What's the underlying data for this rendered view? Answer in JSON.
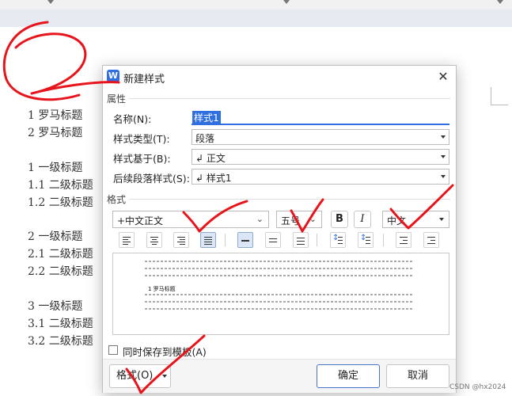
{
  "document": {
    "lines": [
      "1 罗马标题",
      "2 罗马标题",
      "1 一级标题",
      "1.1  二级标题",
      "1.2 二级标题",
      "2 一级标题",
      "2.1  二级标题",
      "2.2 二级标题",
      "3 一级标题",
      "3.1  二级标题",
      "3.2 二级标题"
    ]
  },
  "dialog": {
    "app_icon": "W",
    "title": "新建样式",
    "close_icon": "close-icon",
    "properties_section": "属性",
    "properties": {
      "name_label": "名称(N):",
      "name_value": "样式1",
      "type_label": "样式类型(T):",
      "type_value": "段落",
      "based_on_label": "样式基于(B):",
      "based_on_value": "↲ 正文",
      "next_label": "后续段落样式(S):",
      "next_value": "↲ 样式1"
    },
    "format_section": "格式",
    "format": {
      "font": "+中文正文",
      "size": "五号",
      "bold": "B",
      "italic": "I",
      "lang": "中文"
    },
    "preview": {
      "sample_heading": "1 罗马标题"
    },
    "checkbox_label": "同时保存到模板(A)",
    "format_button": "格式(O)",
    "ok_button": "确定",
    "cancel_button": "取消"
  },
  "watermark": "CSDN @hx2024",
  "colors": {
    "accent": "#2f6fe0",
    "annotation_red": "#e8141b"
  }
}
